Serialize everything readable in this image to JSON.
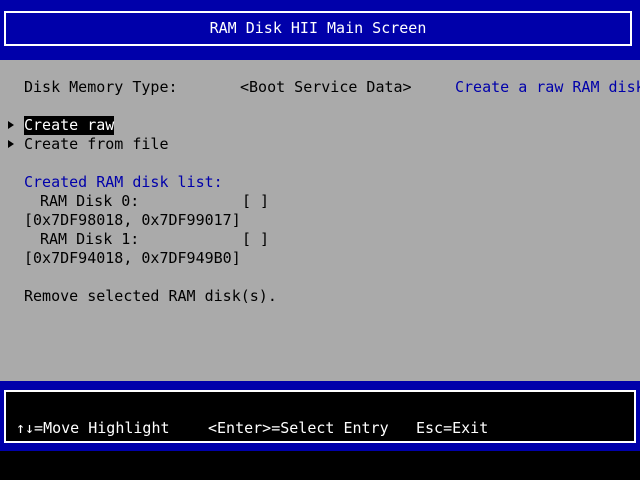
{
  "header": {
    "title": "RAM Disk HII Main Screen"
  },
  "form": {
    "memory_type_label": "Disk Memory Type:",
    "memory_type_value": "<Boot Service Data>",
    "help_text": "Create a raw RAM disk.",
    "actions": [
      {
        "label": "Create raw"
      },
      {
        "label": "Create from file"
      }
    ],
    "list_heading": "Created RAM disk list:",
    "disks": [
      {
        "label": "RAM Disk 0:",
        "checkbox": "[ ]",
        "range": "[0x7DF98018, 0x7DF99017]"
      },
      {
        "label": "RAM Disk 1:",
        "checkbox": "[ ]",
        "range": "[0x7DF94018, 0x7DF949B0]"
      }
    ],
    "remove_label": "Remove selected RAM disk(s)."
  },
  "footer": {
    "move_hint": "↑↓=Move Highlight",
    "enter_hint": "<Enter>=Select Entry",
    "esc_hint": "Esc=Exit"
  },
  "colors": {
    "band_blue": "#0000aa",
    "panel_gray": "#aaaaaa",
    "text_white": "#ffffff",
    "text_black": "#000000",
    "text_blue": "#0000aa"
  },
  "icons": {
    "pointer": "right-triangle-icon"
  }
}
